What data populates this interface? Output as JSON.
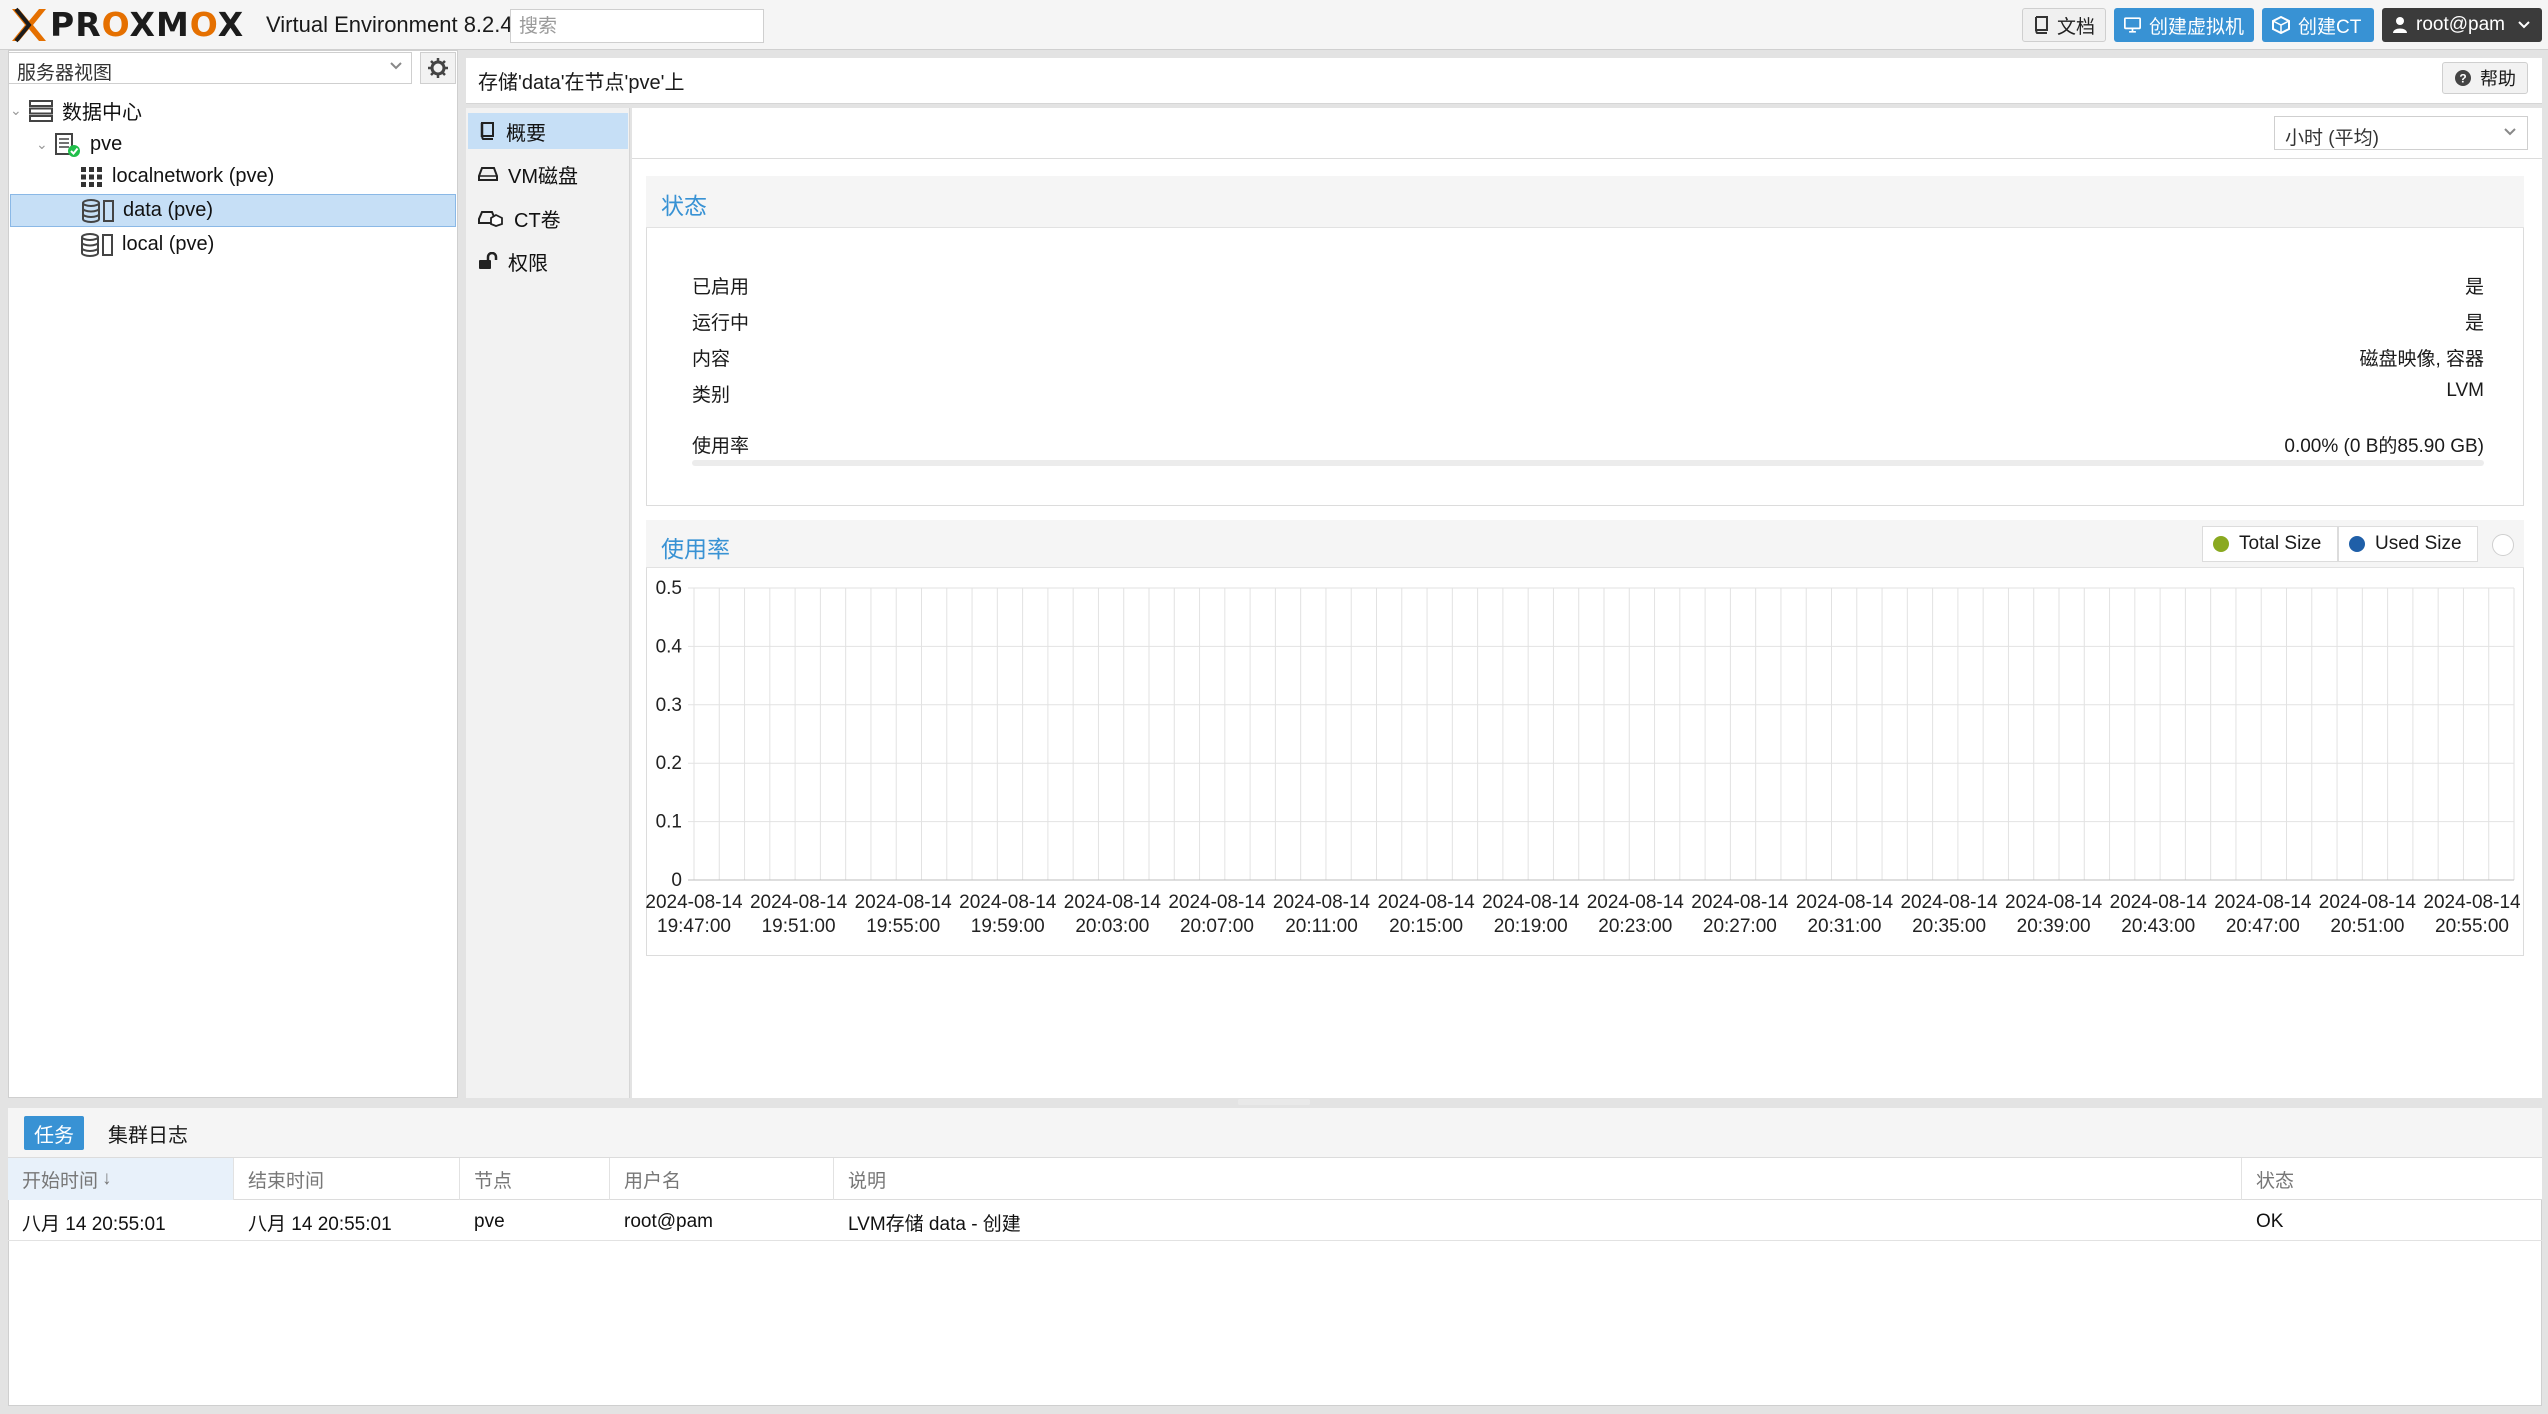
{
  "app": {
    "logo_text": "PROXMOX",
    "version": "Virtual Environment 8.2.4",
    "search_placeholder": "搜索",
    "accent": "#3892d4",
    "logo_orange": "#e57000"
  },
  "topbar": {
    "docs_label": "文档",
    "create_vm_label": "创建虚拟机",
    "create_ct_label": "创建CT",
    "user_label": "root@pam"
  },
  "left": {
    "view_label": "服务器视图",
    "tree": [
      {
        "label": "数据中心",
        "icon": "datacenter-icon"
      },
      {
        "label": "pve",
        "icon": "node-online-icon"
      },
      {
        "label": "localnetwork (pve)",
        "icon": "network-grid-icon"
      },
      {
        "label": "data (pve)",
        "icon": "storage-icon",
        "selected": true
      },
      {
        "label": "local (pve)",
        "icon": "storage-icon"
      }
    ]
  },
  "content": {
    "title": "存储'data'在节点'pve'上",
    "help_label": "帮助",
    "nav": [
      {
        "label": "概要",
        "icon": "book-icon",
        "active": true
      },
      {
        "label": "VM磁盘",
        "icon": "hdd-icon"
      },
      {
        "label": "CT卷",
        "icon": "ct-volume-icon"
      },
      {
        "label": "权限",
        "icon": "unlock-icon"
      }
    ],
    "period_value": "小时 (平均)"
  },
  "status": {
    "title": "状态",
    "rows": [
      {
        "label": "已启用",
        "value": "是"
      },
      {
        "label": "运行中",
        "value": "是"
      },
      {
        "label": "内容",
        "value": "磁盘映像, 容器"
      },
      {
        "label": "类别",
        "value": "LVM"
      },
      {
        "label": "使用率",
        "value": "0.00% (0 B的85.90 GB)"
      }
    ],
    "usage_fraction": 0.0
  },
  "usage": {
    "title": "使用率",
    "legend": [
      {
        "label": "Total Size",
        "color": "#8aa920"
      },
      {
        "label": "Used Size",
        "color": "#1f5fa8"
      }
    ]
  },
  "chart_data": {
    "type": "area",
    "title": "使用率",
    "ylim": [
      0,
      0.5
    ],
    "yticks": [
      "0",
      "0.1",
      "0.2",
      "0.3",
      "0.4",
      "0.5"
    ],
    "xticks": [
      [
        "2024-08-14",
        "19:47:00"
      ],
      [
        "2024-08-14",
        "19:51:00"
      ],
      [
        "2024-08-14",
        "19:55:00"
      ],
      [
        "2024-08-14",
        "19:59:00"
      ],
      [
        "2024-08-14",
        "20:03:00"
      ],
      [
        "2024-08-14",
        "20:07:00"
      ],
      [
        "2024-08-14",
        "20:11:00"
      ],
      [
        "2024-08-14",
        "20:15:00"
      ],
      [
        "2024-08-14",
        "20:19:00"
      ],
      [
        "2024-08-14",
        "20:23:00"
      ],
      [
        "2024-08-14",
        "20:27:00"
      ],
      [
        "2024-08-14",
        "20:31:00"
      ],
      [
        "2024-08-14",
        "20:35:00"
      ],
      [
        "2024-08-14",
        "20:39:00"
      ],
      [
        "2024-08-14",
        "20:43:00"
      ],
      [
        "2024-08-14",
        "20:47:00"
      ],
      [
        "2024-08-14",
        "20:51:00"
      ],
      [
        "2024-08-14",
        "20:55:00"
      ]
    ],
    "grid": true,
    "series": [
      {
        "name": "Total Size",
        "values": []
      },
      {
        "name": "Used Size",
        "values": []
      }
    ]
  },
  "tasks": {
    "tabs": [
      {
        "label": "任务",
        "active": true
      },
      {
        "label": "集群日志",
        "active": false
      }
    ],
    "columns": [
      "开始时间",
      "结束时间",
      "节点",
      "用户名",
      "说明",
      "状态"
    ],
    "sort_arrow": "↓",
    "rows": [
      [
        "八月 14 20:55:01",
        "八月 14 20:55:01",
        "pve",
        "root@pam",
        "LVM存储 data - 创建",
        "OK"
      ]
    ]
  }
}
